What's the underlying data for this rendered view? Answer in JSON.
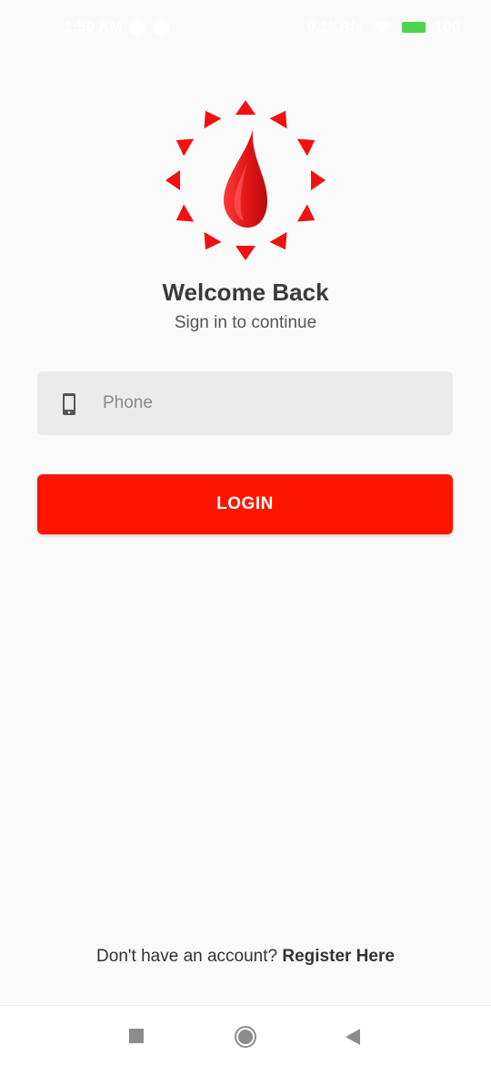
{
  "status_bar": {
    "time": "1:50 AM",
    "net_speed": "0.1KB/s",
    "battery": "100"
  },
  "logo": {
    "icon": "blood-drop-icon",
    "colors": {
      "drop": "#e51b1b",
      "rays": "#f21010"
    }
  },
  "welcome": {
    "title": "Welcome Back",
    "subtitle": "Sign in to continue"
  },
  "phone_field": {
    "icon": "phone-icon",
    "placeholder": "Phone",
    "value": ""
  },
  "login_button": {
    "label": "LOGIN",
    "color": "#ff1400"
  },
  "register": {
    "prompt": "Don't have an account?",
    "link": "Register Here"
  },
  "nav": {
    "recent_icon": "square-icon",
    "home_icon": "circle-icon",
    "back_icon": "triangle-back-icon"
  }
}
